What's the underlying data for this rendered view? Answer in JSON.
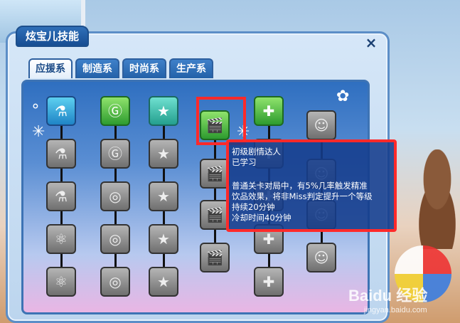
{
  "window": {
    "title": "炫宝儿技能",
    "close_glyph": "×"
  },
  "tabs": [
    {
      "label": "应援系",
      "active": true
    },
    {
      "label": "制造系",
      "active": false
    },
    {
      "label": "时尚系",
      "active": false
    },
    {
      "label": "生产系",
      "active": false
    }
  ],
  "skill_columns": [
    {
      "icons": [
        "test-tube-icon",
        "test-tubes-icon",
        "flasks-icon",
        "molecule-icon",
        "molecule-cluster-icon"
      ],
      "states": [
        "lit-blue",
        "gray",
        "gray",
        "gray",
        "gray"
      ]
    },
    {
      "icons": [
        "g-coin-icon",
        "g-coin-up-icon",
        "coins-icon",
        "coin-stack-icon",
        "coin-pile-icon"
      ],
      "states": [
        "lit-green",
        "gray",
        "gray",
        "gray",
        "gray"
      ]
    },
    {
      "icons": [
        "star-badge-icon",
        "star-badge-2-icon",
        "star-badge-3-icon",
        "star-badge-4-icon",
        "star-badge-5-icon"
      ],
      "states": [
        "lit-teal",
        "gray",
        "gray",
        "gray",
        "gray"
      ]
    },
    {
      "icons": [
        "clapperboard-icon",
        "clapperboard-star-icon",
        "clapperboard-moon-icon",
        "clapperboard-sun-icon"
      ],
      "states": [
        "lit-green",
        "gray",
        "gray",
        "gray"
      ]
    },
    {
      "icons": [
        "medkit-plus-icon",
        "medkit-icon",
        "medkit-2-icon",
        "medkit-3-icon",
        "medkit-4-icon"
      ],
      "states": [
        "lit-green",
        "gray",
        "gray",
        "gray",
        "gray"
      ]
    },
    {
      "icons": [
        "user-up-icon",
        "user-exp-icon",
        "user-exp-2-icon",
        "user-exp-3-icon"
      ],
      "states": [
        "gray",
        "gray",
        "gray",
        "gray"
      ]
    }
  ],
  "tooltip": {
    "name": "初级剧情达人",
    "status": "已学习",
    "description": "普通关卡对局中，有5%几率触发精准\n饮品效果，将非Miss判定提升一个等级",
    "duration": "持续20分钟",
    "cooldown": "冷却时间40分钟"
  },
  "watermark": {
    "brand": "Baidu 经验",
    "url": "jingyan.baidu.com"
  },
  "colors": {
    "highlight": "#ff2a2a",
    "accent": "#2361a8"
  }
}
